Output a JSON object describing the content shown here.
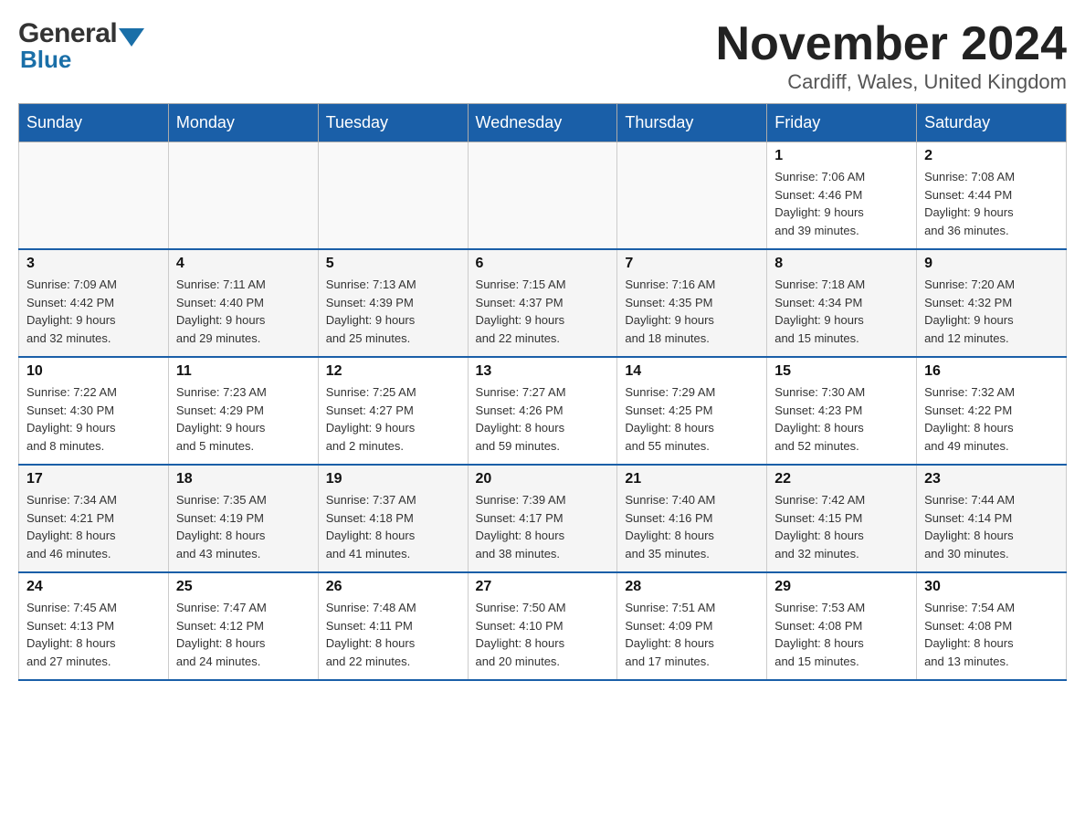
{
  "logo": {
    "general": "General",
    "arrow": "▼",
    "blue": "Blue"
  },
  "title": "November 2024",
  "subtitle": "Cardiff, Wales, United Kingdom",
  "weekdays": [
    "Sunday",
    "Monday",
    "Tuesday",
    "Wednesday",
    "Thursday",
    "Friday",
    "Saturday"
  ],
  "weeks": [
    [
      {
        "day": "",
        "info": ""
      },
      {
        "day": "",
        "info": ""
      },
      {
        "day": "",
        "info": ""
      },
      {
        "day": "",
        "info": ""
      },
      {
        "day": "",
        "info": ""
      },
      {
        "day": "1",
        "info": "Sunrise: 7:06 AM\nSunset: 4:46 PM\nDaylight: 9 hours\nand 39 minutes."
      },
      {
        "day": "2",
        "info": "Sunrise: 7:08 AM\nSunset: 4:44 PM\nDaylight: 9 hours\nand 36 minutes."
      }
    ],
    [
      {
        "day": "3",
        "info": "Sunrise: 7:09 AM\nSunset: 4:42 PM\nDaylight: 9 hours\nand 32 minutes."
      },
      {
        "day": "4",
        "info": "Sunrise: 7:11 AM\nSunset: 4:40 PM\nDaylight: 9 hours\nand 29 minutes."
      },
      {
        "day": "5",
        "info": "Sunrise: 7:13 AM\nSunset: 4:39 PM\nDaylight: 9 hours\nand 25 minutes."
      },
      {
        "day": "6",
        "info": "Sunrise: 7:15 AM\nSunset: 4:37 PM\nDaylight: 9 hours\nand 22 minutes."
      },
      {
        "day": "7",
        "info": "Sunrise: 7:16 AM\nSunset: 4:35 PM\nDaylight: 9 hours\nand 18 minutes."
      },
      {
        "day": "8",
        "info": "Sunrise: 7:18 AM\nSunset: 4:34 PM\nDaylight: 9 hours\nand 15 minutes."
      },
      {
        "day": "9",
        "info": "Sunrise: 7:20 AM\nSunset: 4:32 PM\nDaylight: 9 hours\nand 12 minutes."
      }
    ],
    [
      {
        "day": "10",
        "info": "Sunrise: 7:22 AM\nSunset: 4:30 PM\nDaylight: 9 hours\nand 8 minutes."
      },
      {
        "day": "11",
        "info": "Sunrise: 7:23 AM\nSunset: 4:29 PM\nDaylight: 9 hours\nand 5 minutes."
      },
      {
        "day": "12",
        "info": "Sunrise: 7:25 AM\nSunset: 4:27 PM\nDaylight: 9 hours\nand 2 minutes."
      },
      {
        "day": "13",
        "info": "Sunrise: 7:27 AM\nSunset: 4:26 PM\nDaylight: 8 hours\nand 59 minutes."
      },
      {
        "day": "14",
        "info": "Sunrise: 7:29 AM\nSunset: 4:25 PM\nDaylight: 8 hours\nand 55 minutes."
      },
      {
        "day": "15",
        "info": "Sunrise: 7:30 AM\nSunset: 4:23 PM\nDaylight: 8 hours\nand 52 minutes."
      },
      {
        "day": "16",
        "info": "Sunrise: 7:32 AM\nSunset: 4:22 PM\nDaylight: 8 hours\nand 49 minutes."
      }
    ],
    [
      {
        "day": "17",
        "info": "Sunrise: 7:34 AM\nSunset: 4:21 PM\nDaylight: 8 hours\nand 46 minutes."
      },
      {
        "day": "18",
        "info": "Sunrise: 7:35 AM\nSunset: 4:19 PM\nDaylight: 8 hours\nand 43 minutes."
      },
      {
        "day": "19",
        "info": "Sunrise: 7:37 AM\nSunset: 4:18 PM\nDaylight: 8 hours\nand 41 minutes."
      },
      {
        "day": "20",
        "info": "Sunrise: 7:39 AM\nSunset: 4:17 PM\nDaylight: 8 hours\nand 38 minutes."
      },
      {
        "day": "21",
        "info": "Sunrise: 7:40 AM\nSunset: 4:16 PM\nDaylight: 8 hours\nand 35 minutes."
      },
      {
        "day": "22",
        "info": "Sunrise: 7:42 AM\nSunset: 4:15 PM\nDaylight: 8 hours\nand 32 minutes."
      },
      {
        "day": "23",
        "info": "Sunrise: 7:44 AM\nSunset: 4:14 PM\nDaylight: 8 hours\nand 30 minutes."
      }
    ],
    [
      {
        "day": "24",
        "info": "Sunrise: 7:45 AM\nSunset: 4:13 PM\nDaylight: 8 hours\nand 27 minutes."
      },
      {
        "day": "25",
        "info": "Sunrise: 7:47 AM\nSunset: 4:12 PM\nDaylight: 8 hours\nand 24 minutes."
      },
      {
        "day": "26",
        "info": "Sunrise: 7:48 AM\nSunset: 4:11 PM\nDaylight: 8 hours\nand 22 minutes."
      },
      {
        "day": "27",
        "info": "Sunrise: 7:50 AM\nSunset: 4:10 PM\nDaylight: 8 hours\nand 20 minutes."
      },
      {
        "day": "28",
        "info": "Sunrise: 7:51 AM\nSunset: 4:09 PM\nDaylight: 8 hours\nand 17 minutes."
      },
      {
        "day": "29",
        "info": "Sunrise: 7:53 AM\nSunset: 4:08 PM\nDaylight: 8 hours\nand 15 minutes."
      },
      {
        "day": "30",
        "info": "Sunrise: 7:54 AM\nSunset: 4:08 PM\nDaylight: 8 hours\nand 13 minutes."
      }
    ]
  ]
}
